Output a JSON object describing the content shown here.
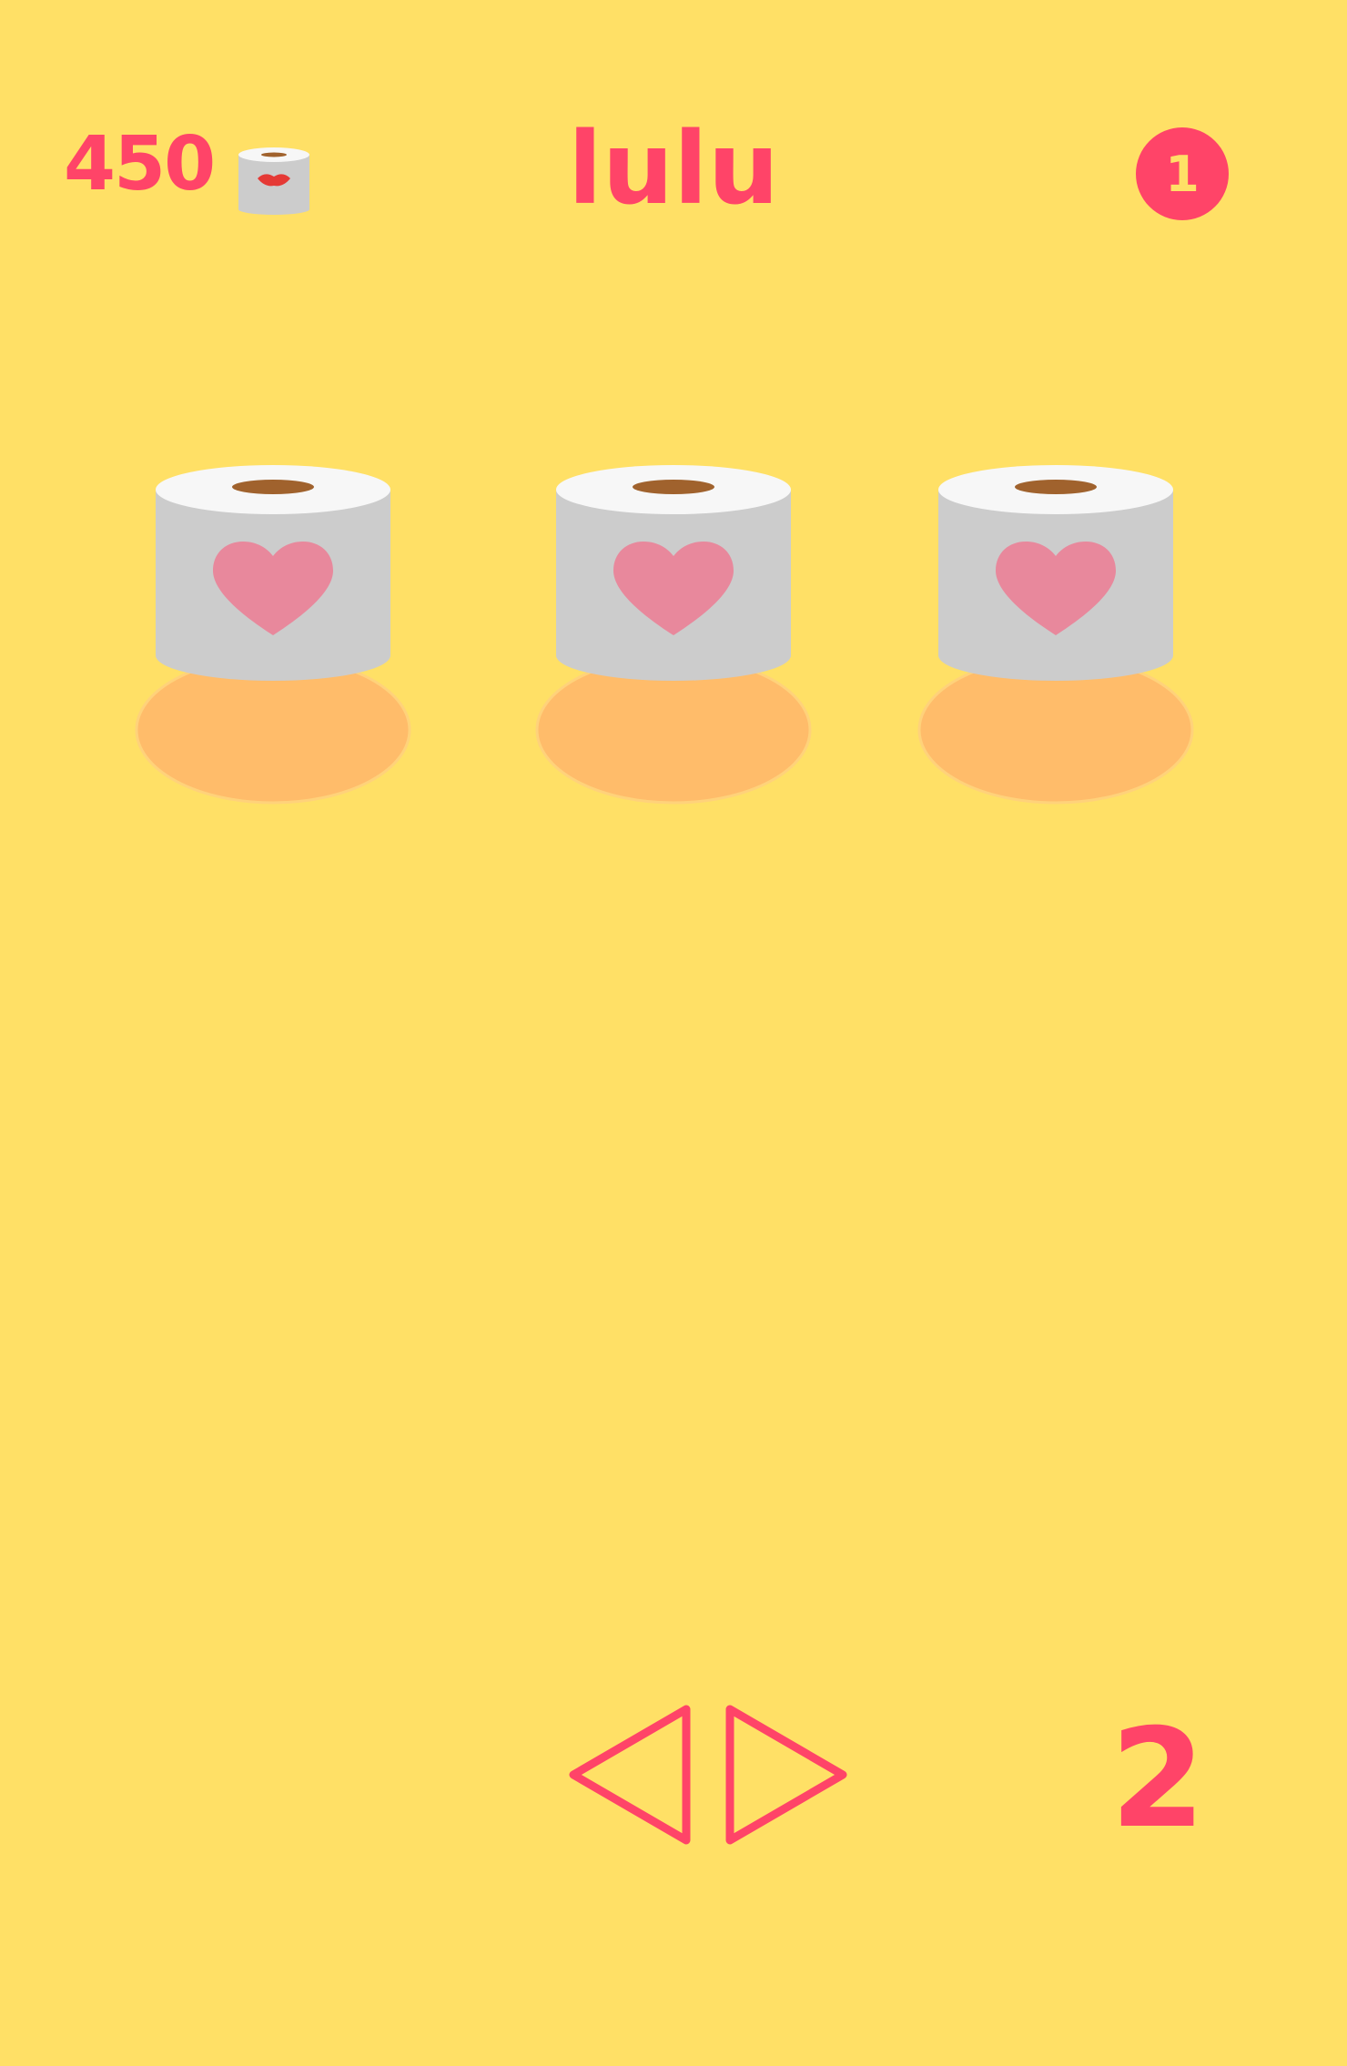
{
  "header": {
    "score": "450",
    "score_icon": "toilet-roll-lips-icon",
    "title": "lulu",
    "level": "1"
  },
  "rolls": [
    {
      "name": "roll-1",
      "icon": "heart-icon"
    },
    {
      "name": "roll-2",
      "icon": "heart-icon"
    },
    {
      "name": "roll-3",
      "icon": "heart-icon"
    }
  ],
  "footer": {
    "prev_icon": "triangle-left-icon",
    "next_icon": "triangle-right-icon",
    "page": "2"
  },
  "colors": {
    "background": "#FFE066",
    "accent": "#FF4468",
    "roll_body": "#CCCCCC",
    "roll_top": "#F7F7F7",
    "roll_core": "#A0622D",
    "heart": "#E8889C",
    "shadow": "#FFBC6A",
    "lips": "#E53935"
  }
}
